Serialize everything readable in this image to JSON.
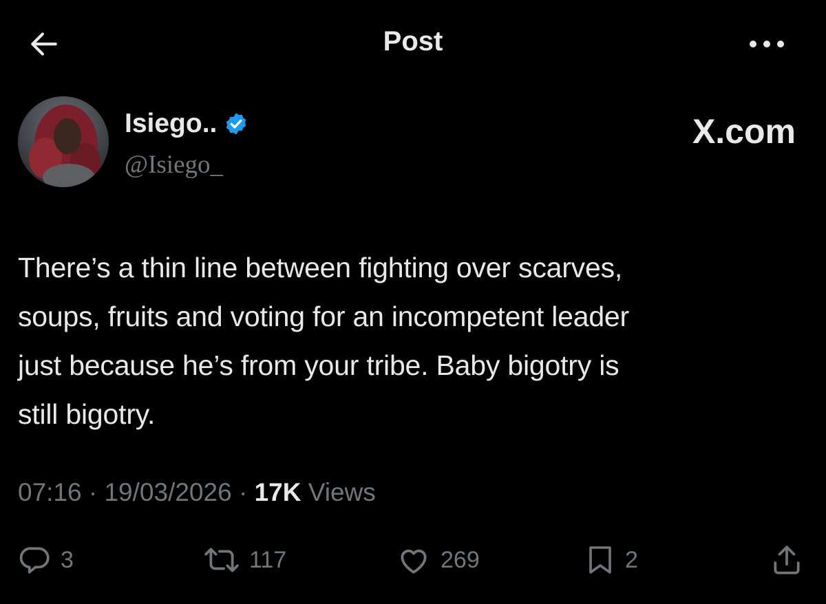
{
  "header": {
    "title": "Post",
    "back_icon": "arrow-left-icon",
    "more_icon": "more-horizontal-icon"
  },
  "author": {
    "display_name": "Isiego..",
    "handle": "@Isiego_",
    "verified": true,
    "verified_color": "#1d9bf0"
  },
  "brand": "X.com",
  "post": {
    "lines": [
      "There’s a thin line between fighting over scarves,",
      "soups, fruits and voting for an incompetent leader",
      "just because he’s from your tribe. Baby bigotry is",
      "still bigotry."
    ]
  },
  "meta": {
    "time": "07:16",
    "sep1": "·",
    "date": "19/03/2026",
    "sep2": "·",
    "views_count": "17K",
    "views_label": "Views"
  },
  "actions": {
    "replies": "3",
    "reposts": "117",
    "likes": "269",
    "bookmarks": "2"
  },
  "colors": {
    "background": "#000000",
    "text": "#e7e9ea",
    "muted": "#71767b",
    "accent": "#1d9bf0"
  }
}
